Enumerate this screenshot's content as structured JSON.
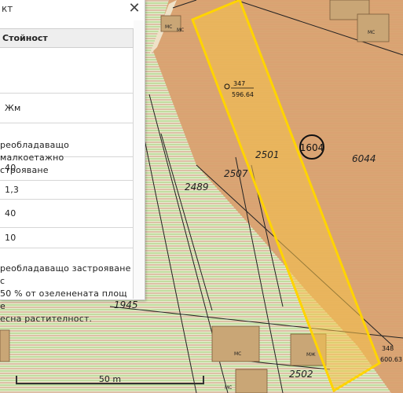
{
  "panel": {
    "title": "кт",
    "close_label": "✕",
    "column_header": "Стойност",
    "rows": [
      {
        "value": ""
      },
      {
        "value": "Жм"
      },
      {
        "value": "реобладаващо малкоетажно\nстрояване"
      },
      {
        "value": "40"
      },
      {
        "value": "1,3"
      },
      {
        "value": "40"
      },
      {
        "value": "10"
      },
      {
        "value": "реобладаващо застрояване с\n50 % от озеленената площ е\nесна растителност."
      }
    ]
  },
  "map": {
    "parcel_labels": [
      "347",
      "596.64",
      "2501",
      "6044",
      "2507",
      "2489",
      "1945",
      "2502",
      "348",
      "600.63"
    ],
    "zone_badge": "1604",
    "building_labels": [
      "МС",
      "МС",
      "МС",
      "МС",
      "МЖ",
      "МС"
    ],
    "highlight_color": "#ffd400",
    "zone_fill_color": "#d9a070"
  },
  "scale": {
    "label": "50 m"
  }
}
